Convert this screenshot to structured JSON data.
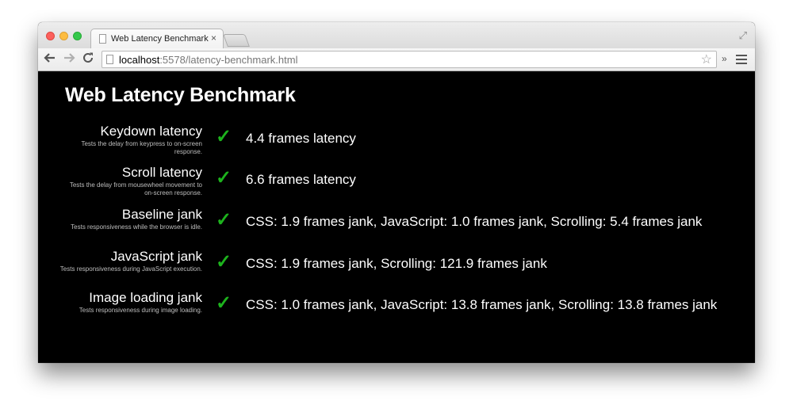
{
  "browser": {
    "tab_title": "Web Latency Benchmark",
    "tab_close": "×",
    "url_host": "localhost",
    "url_rest": ":5578/latency-benchmark.html",
    "overflow": "»"
  },
  "icons": {
    "back": "back-arrow-icon",
    "forward": "forward-arrow-icon",
    "reload": "reload-icon",
    "star": "bookmark-star-icon",
    "menu": "hamburger-menu-icon",
    "check": "checkmark-icon"
  },
  "colors": {
    "background": "#000000",
    "check": "#1db31d",
    "text": "#ffffff",
    "description": "#bdbdbd"
  },
  "page": {
    "title": "Web Latency Benchmark"
  },
  "tests": [
    {
      "title": "Keydown latency",
      "description": "Tests the delay from keypress to on-screen response.",
      "status": "✓",
      "result": "4.4 frames latency"
    },
    {
      "title": "Scroll latency",
      "description": "Tests the delay from mousewheel movement to on-screen response.",
      "status": "✓",
      "result": "6.6 frames latency"
    },
    {
      "title": "Baseline jank",
      "description": "Tests responsiveness while the browser is idle.",
      "status": "✓",
      "result": "CSS: 1.9 frames jank, JavaScript: 1.0 frames jank, Scrolling: 5.4 frames jank"
    },
    {
      "title": "JavaScript jank",
      "description": "Tests responsiveness during JavaScript execution.",
      "status": "✓",
      "result": "CSS: 1.9 frames jank, Scrolling: 121.9 frames jank"
    },
    {
      "title": "Image loading jank",
      "description": "Tests responsiveness during image loading.",
      "status": "✓",
      "result": "CSS: 1.0 frames jank, JavaScript: 13.8 frames jank, Scrolling: 13.8 frames jank"
    }
  ]
}
